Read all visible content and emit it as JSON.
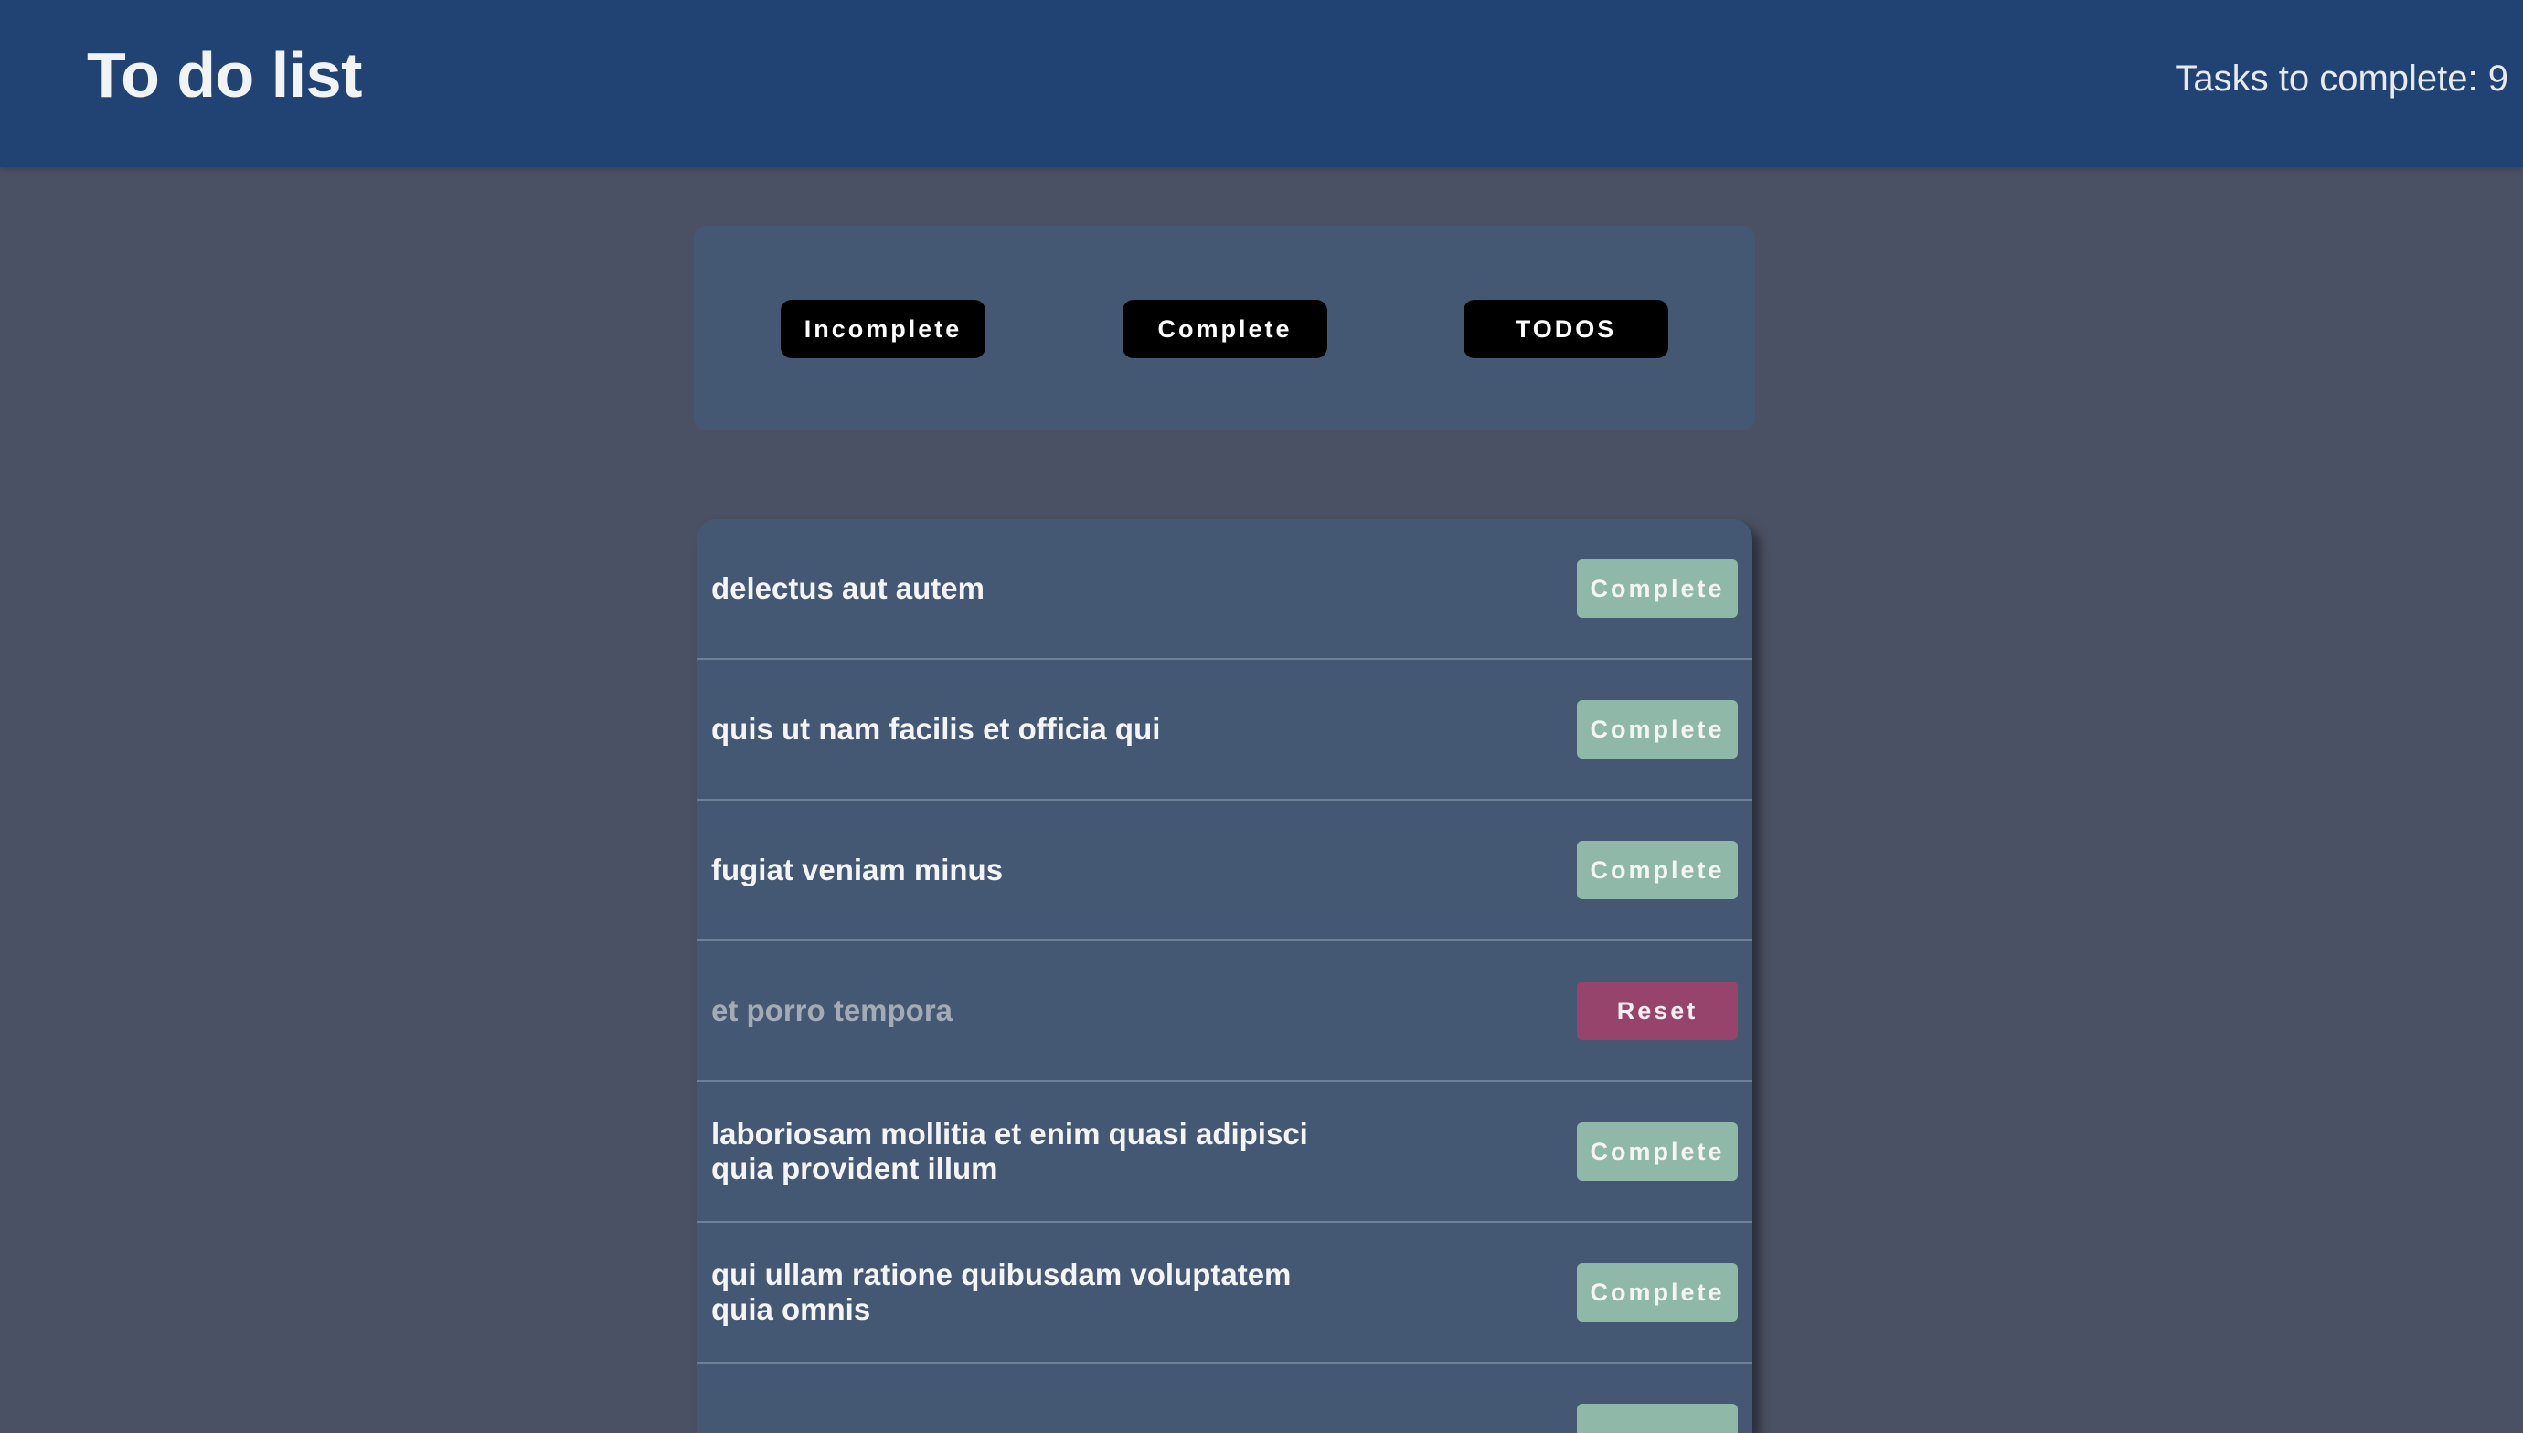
{
  "header": {
    "title": "To do list",
    "counter": "Tasks to complete: 9"
  },
  "filters": {
    "incomplete": "Incomplete",
    "complete": "Complete",
    "todos": "TODOS"
  },
  "todos": [
    {
      "text": "delectus aut autem",
      "action": "Complete",
      "completed": false
    },
    {
      "text": "quis ut nam facilis et officia qui",
      "action": "Complete",
      "completed": false
    },
    {
      "text": "fugiat veniam minus",
      "action": "Complete",
      "completed": false
    },
    {
      "text": "et porro tempora",
      "action": "Reset",
      "completed": true
    },
    {
      "text": "laboriosam mollitia et enim quasi adipisci quia provident illum",
      "action": "Complete",
      "completed": false
    },
    {
      "text": "qui ullam ratione quibusdam voluptatem quia omnis",
      "action": "Complete",
      "completed": false
    },
    {
      "text": "",
      "action": "",
      "completed": false
    }
  ],
  "colors": {
    "header_bg": "#214373",
    "page_bg": "#4b5164",
    "panel_bg": "#445873",
    "complete_btn": "#8fb8a9",
    "reset_btn": "#97446c"
  }
}
